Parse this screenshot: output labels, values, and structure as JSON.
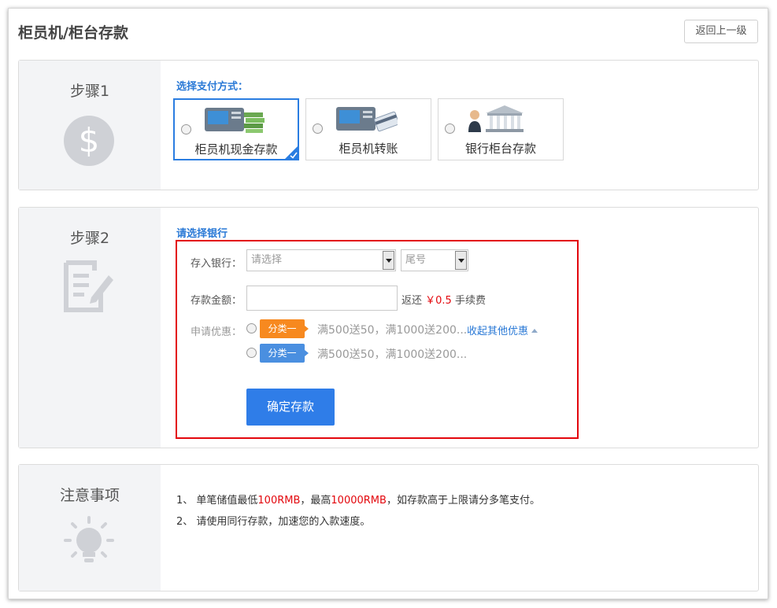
{
  "header": {
    "title": "柜员机/柜台存款",
    "back_label": "返回上一级"
  },
  "step1": {
    "title": "步骤1",
    "section_label": "选择支付方式：",
    "options": [
      {
        "label": "柜员机现金存款",
        "selected": true
      },
      {
        "label": "柜员机转账",
        "selected": false
      },
      {
        "label": "银行柜台存款",
        "selected": false
      }
    ]
  },
  "step2": {
    "title": "步骤2",
    "section_label": "请选择银行",
    "bank_label": "存入银行：",
    "bank_placeholder": "请选择",
    "tail_placeholder": "尾号",
    "amount_label": "存款金额：",
    "amount_value": "",
    "fee_prefix": "返还",
    "fee_value": "￥0.5",
    "fee_suffix": "手续费",
    "promo_label": "申请优惠：",
    "promos": [
      {
        "tag": "分类一",
        "text": "满500送50，满1000送200...",
        "color": "#f7891f"
      },
      {
        "tag": "分类一",
        "text": "满500送50，满1000送200...",
        "color": "#4a8fe0"
      }
    ],
    "collapse_link": "收起其他优惠",
    "confirm_label": "确定存款"
  },
  "notice": {
    "title": "注意事项",
    "line1": {
      "prefix": "1、  单笔储值最低",
      "min": "100RMB",
      "middle": "，最高",
      "max": "10000RMB",
      "suffix": "，如存款高于上限请分多笔支付。"
    },
    "line2": "2、  请使用同行存款，加速您的入款速度。"
  },
  "colors": {
    "accent": "#2a79d6",
    "highlight_border": "#e3070d",
    "confirm_button": "#2f7de8"
  }
}
